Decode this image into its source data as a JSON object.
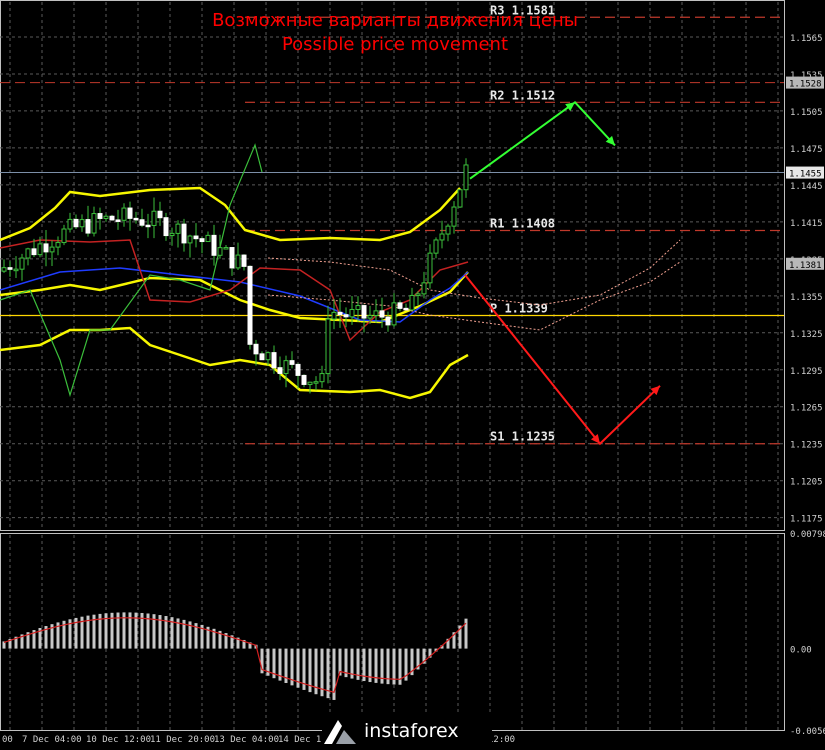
{
  "title": "Возможные варианты движения цены",
  "subtitle": "Possible price movement",
  "logo": "instaforex",
  "chart_data": [
    {
      "type": "candlestick",
      "name": "main",
      "ylim": [
        1.1165,
        1.1595
      ],
      "y_ticks": [
        "1.1565",
        "1.1535",
        "1.1505",
        "1.1475",
        "1.1445",
        "1.1415",
        "1.1385",
        "1.1355",
        "1.1325",
        "1.1295",
        "1.1265",
        "1.1235",
        "1.1205",
        "1.1175"
      ],
      "current_price_labels": [
        "1.1528",
        "1.1455",
        "1.1381"
      ],
      "x_ticks": [
        "00",
        "7 Dec 04:00",
        "10 Dec 12:00",
        "11 Dec 20:00",
        "13 Dec 04:00",
        "14 Dec 12:00",
        "12:00"
      ],
      "levels": [
        {
          "label": "R3",
          "value": "1.1581",
          "color": "#c0392b"
        },
        {
          "label": "R2",
          "value": "1.1512",
          "color": "#c0392b"
        },
        {
          "label": "R1",
          "value": "1.1408",
          "color": "#c0392b"
        },
        {
          "label": "P",
          "value": "1.1339",
          "color": "#ffd700"
        },
        {
          "label": "S1",
          "value": "1.1235",
          "color": "#c0392b"
        }
      ],
      "forecast_arrows": [
        {
          "color": "#33ff33",
          "path": [
            1.145,
            1.1512,
            1.1477
          ]
        },
        {
          "color": "#ff1a1a",
          "path": [
            1.1372,
            1.1235,
            1.1282
          ]
        }
      ]
    },
    {
      "type": "histogram",
      "name": "oscillator",
      "ylim": [
        -0.00562,
        0.00798
      ],
      "y_ticks": [
        "0.00798",
        "0.00",
        "-0.00562"
      ]
    }
  ]
}
